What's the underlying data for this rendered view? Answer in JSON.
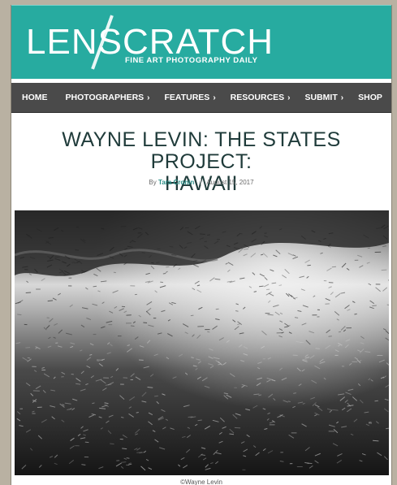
{
  "site": {
    "logo_text": "LENSCRATCH",
    "tagline": "FINE ART PHOTOGRAPHY DAILY",
    "brand_color": "#27aba0"
  },
  "nav": {
    "items": [
      {
        "label": "HOME",
        "has_menu": false
      },
      {
        "label": "PHOTOGRAPHERS",
        "has_menu": true
      },
      {
        "label": "FEATURES",
        "has_menu": true
      },
      {
        "label": "RESOURCES",
        "has_menu": true
      },
      {
        "label": "SUBMIT",
        "has_menu": true
      },
      {
        "label": "SHOP",
        "has_menu": false
      }
    ],
    "chevron": "›"
  },
  "article": {
    "title_line1": "WAYNE LEVIN: THE STATES PROJECT:",
    "title_line2": "HAWAII",
    "by": "By",
    "author": "Tara Cronin",
    "date": "August 15, 2017",
    "photo_alt": "Underwater black and white photograph of a school of fish",
    "credit": "©Wayne Levin"
  }
}
